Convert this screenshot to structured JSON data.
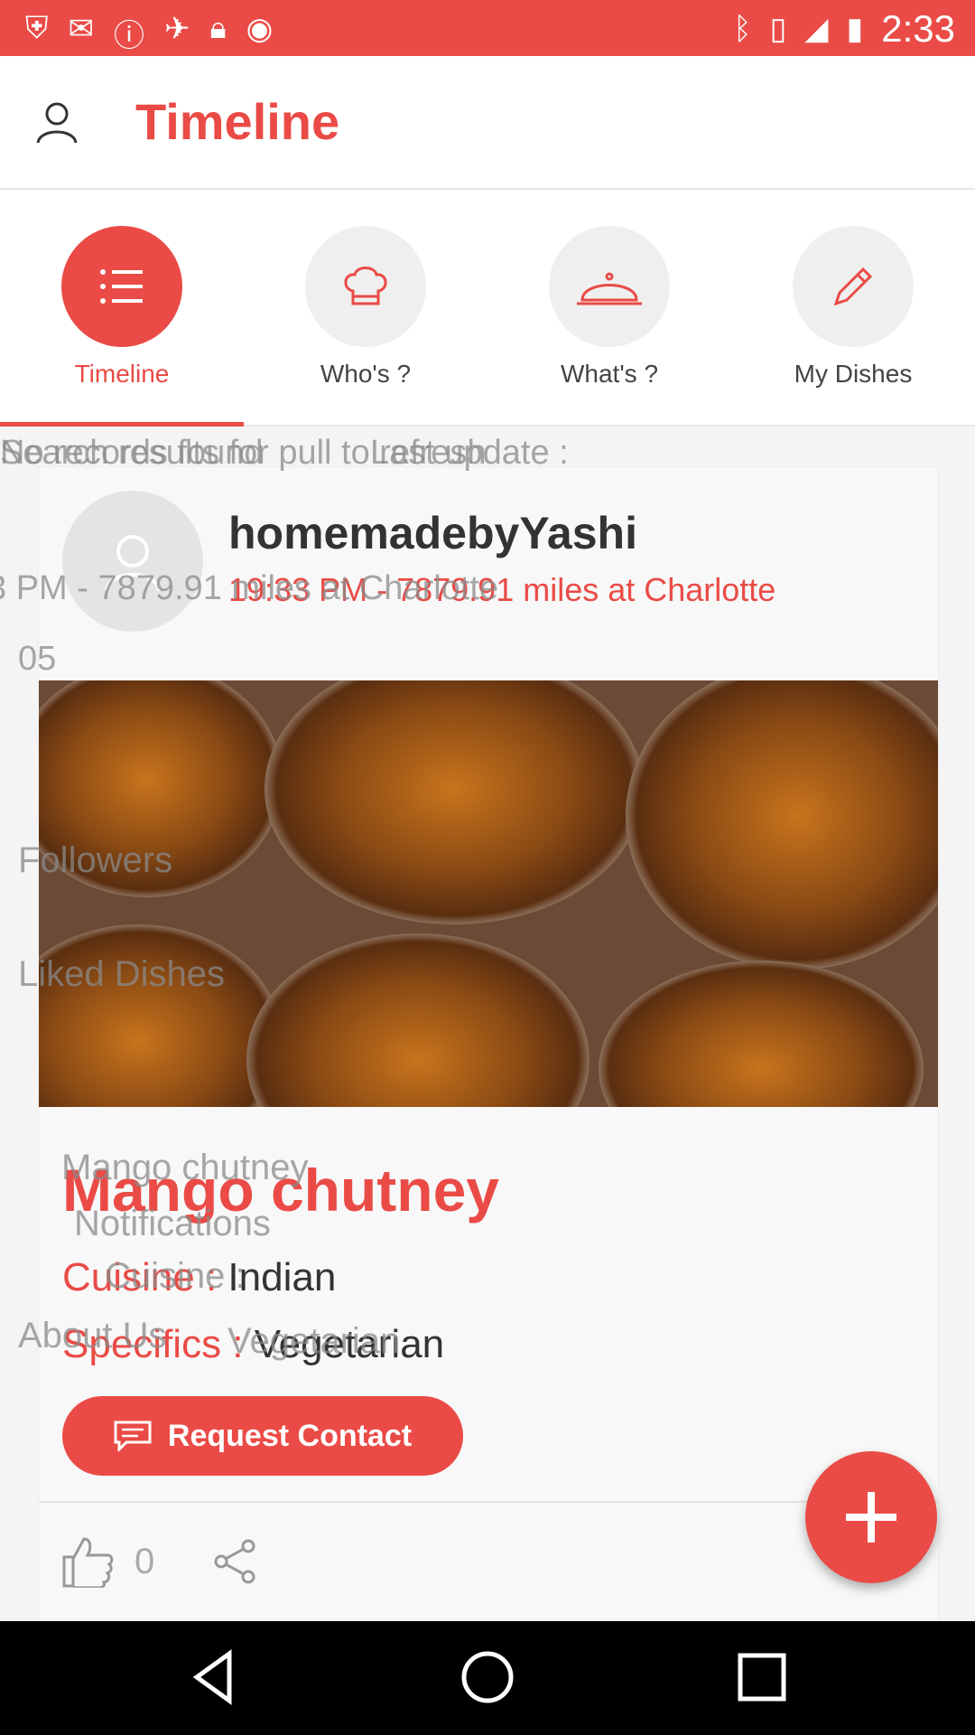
{
  "colors": {
    "accent": "#ea4b46",
    "text": "#333333"
  },
  "status_bar": {
    "time": "2:33",
    "left_icons": [
      "shield-icon",
      "mail-icon",
      "alert-icon",
      "fake-gps-icon",
      "lock-icon",
      "android-icon"
    ],
    "right_icons": [
      "bluetooth-icon",
      "vibrate-icon",
      "signal-icon",
      "battery-icon"
    ]
  },
  "appbar": {
    "title": "Timeline"
  },
  "tabs": [
    {
      "label": "Timeline",
      "icon": "list-icon",
      "active": true
    },
    {
      "label": "Who's ?",
      "icon": "chef-hat-icon",
      "active": false
    },
    {
      "label": "What's ?",
      "icon": "cloche-icon",
      "active": false
    },
    {
      "label": "My Dishes",
      "icon": "pencil-icon",
      "active": false
    }
  ],
  "ghost_drawer": {
    "search_results": "Search results for pull to refresh",
    "no_records": "No records found",
    "last_update": "Last update :",
    "meta_left": "3 PM - 7879.91 miles at Charlotte",
    "count": "05",
    "followers": "Followers",
    "liked_dishes": "Liked Dishes",
    "dish_name": "Mango chutney",
    "notifications": "Notifications",
    "cuisine": "Cuisine :",
    "about_us": "About Us",
    "vegetarian": "Vegetarian"
  },
  "post": {
    "username": "homemadebyYashi",
    "meta": "19:33 PM - 7879.91 miles at Charlotte",
    "dish_title": "Mango chutney",
    "cuisine_key": "Cuisine :",
    "cuisine_value": "Indian",
    "specifics_key": "Specifics :",
    "specifics_value": "Vegetarian",
    "request_button": "Request Contact",
    "likes": "0"
  }
}
